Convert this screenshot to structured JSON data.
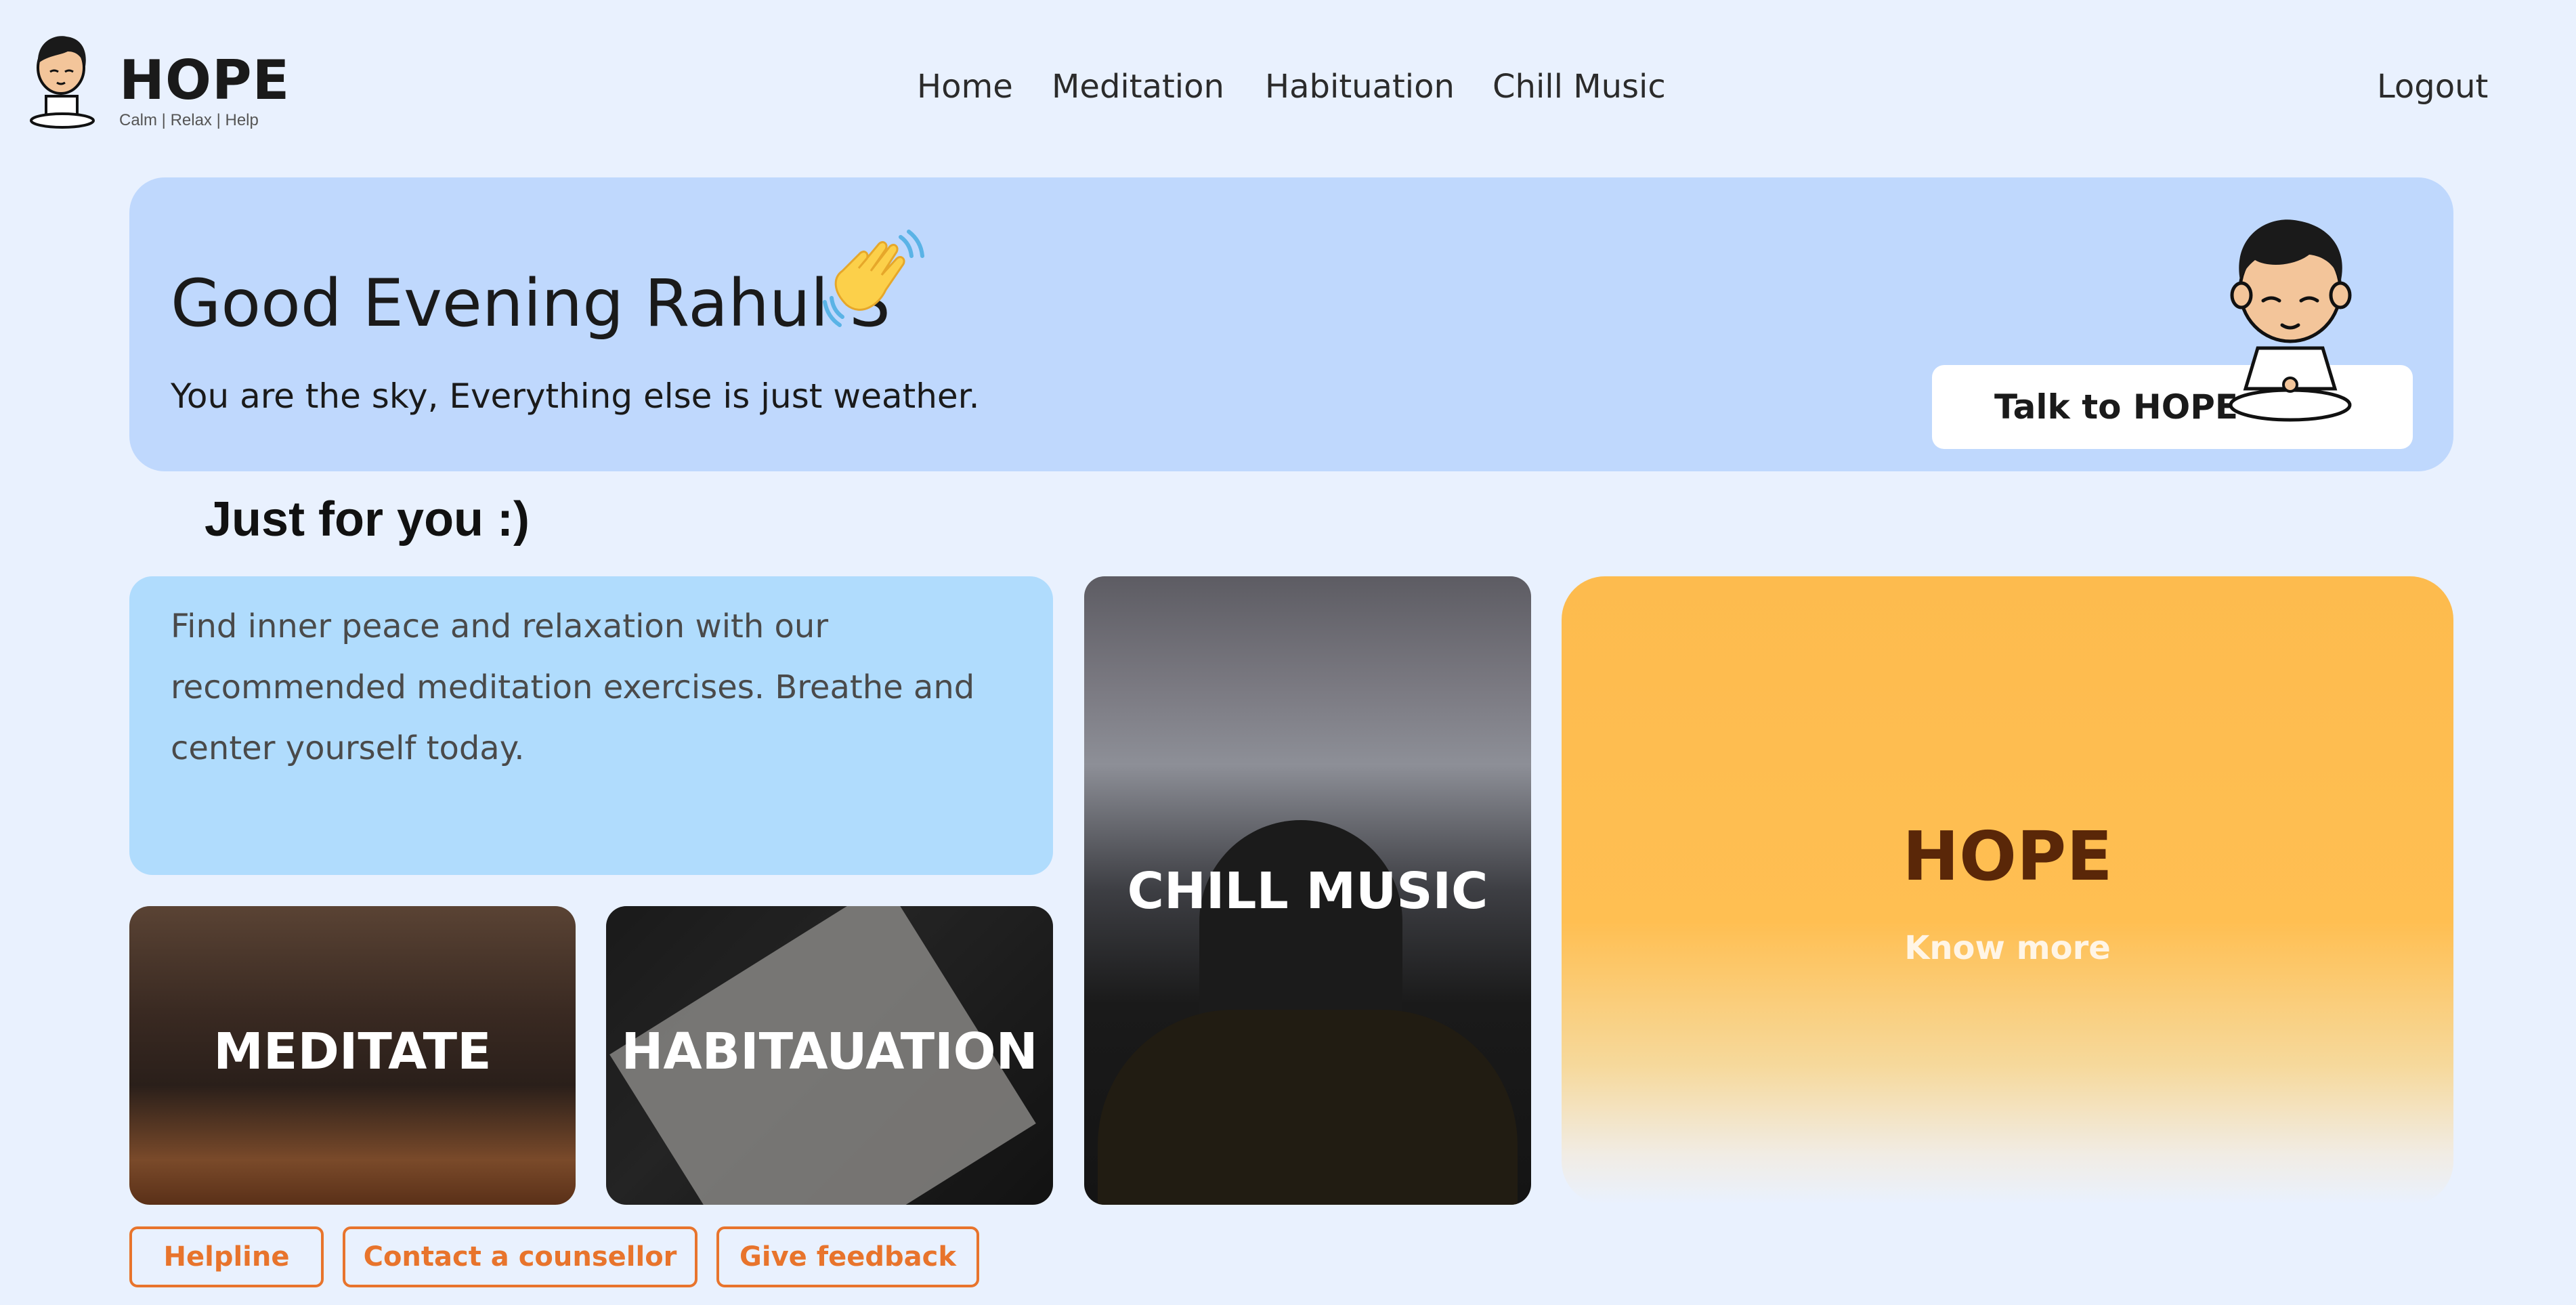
{
  "brand": {
    "title": "HOPE",
    "tagline": "Calm | Relax | Help"
  },
  "nav": {
    "items": [
      {
        "label": "Home"
      },
      {
        "label": "Meditation"
      },
      {
        "label": "Habituation"
      },
      {
        "label": "Chill Music"
      }
    ],
    "logout_label": "Logout"
  },
  "hero": {
    "greeting": "Good Evening Rahul S",
    "quote": "You are the sky, Everything else is just weather.",
    "cta_label": "Talk to HOPE"
  },
  "section": {
    "title": "Just for you :)"
  },
  "recommendation": {
    "text": "Find inner peace and relaxation with our recommended meditation exercises. Breathe and center yourself today."
  },
  "tiles": {
    "meditate": "MEDITATE",
    "habituation": "HABITAUATION",
    "chill_music": "CHILL MUSIC"
  },
  "hope_card": {
    "title": "HOPE",
    "link": "Know more"
  },
  "footer_buttons": {
    "helpline": "Helpline",
    "counsellor": "Contact a counsellor",
    "feedback": "Give feedback"
  },
  "colors": {
    "page_bg": "#e9f1fe",
    "hero_bg": "#bfd8fd",
    "info_bg": "#b0dcfd",
    "hope_card": "#ffbf52",
    "accent_orange": "#e8742c"
  }
}
